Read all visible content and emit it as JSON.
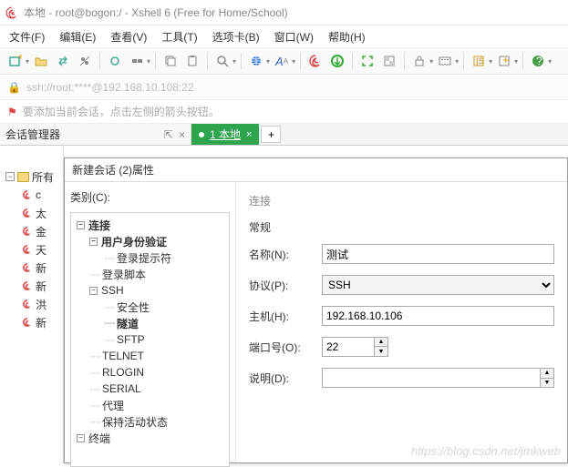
{
  "window": {
    "title": "本地 - root@bogon:/ - Xshell 6 (Free for Home/School)"
  },
  "menu": {
    "file": "文件(F)",
    "edit": "编辑(E)",
    "view": "查看(V)",
    "tools": "工具(T)",
    "tabs": "选项卡(B)",
    "window": "窗口(W)",
    "help": "帮助(H)"
  },
  "address": {
    "url": "ssh://root:****@192.168.10.108:22"
  },
  "hint": {
    "text": "要添加当前会话，点击左侧的箭头按钮。"
  },
  "panel": {
    "title": "会话管理器"
  },
  "tab": {
    "label": "1 本地"
  },
  "sidebar": {
    "root": "所有",
    "items": [
      "c",
      "太",
      "金",
      "天",
      "新",
      "新",
      "洪",
      "新"
    ]
  },
  "dialog": {
    "title": "新建会话 (2)属性",
    "category_label": "类别(C):",
    "tree": {
      "connection": "连接",
      "auth": "用户身份验证",
      "login_prompt": "登录提示符",
      "login_script": "登录脚本",
      "ssh": "SSH",
      "security": "安全性",
      "tunnel": "隧道",
      "sftp": "SFTP",
      "telnet": "TELNET",
      "rlogin": "RLOGIN",
      "serial": "SERIAL",
      "proxy": "代理",
      "keepalive": "保持活动状态",
      "terminal": "终端"
    },
    "right": {
      "section": "连接",
      "group": "常规",
      "name_label": "名称(N):",
      "name_value": "测试",
      "proto_label": "协议(P):",
      "proto_value": "SSH",
      "host_label": "主机(H):",
      "host_value": "192.168.10.106",
      "port_label": "端口号(O):",
      "port_value": "22",
      "desc_label": "说明(D):"
    }
  },
  "watermark": "https://blog.csdn.net/jmkweb"
}
